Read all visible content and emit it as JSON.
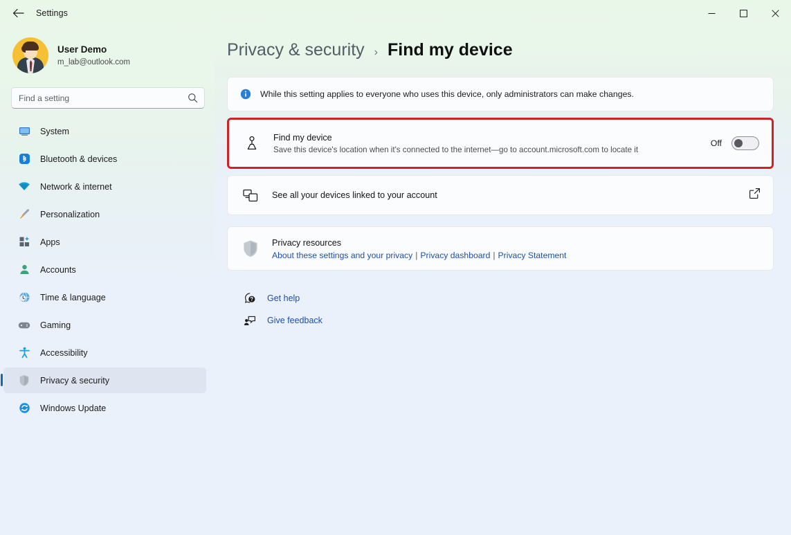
{
  "window": {
    "title": "Settings",
    "back_tooltip": "Back",
    "minimize": "Minimize",
    "maximize": "Maximize",
    "close": "Close",
    "accent_blue": "#1b4fa8",
    "highlight_red": "#cf2128",
    "mica_green": "#e9f7e9",
    "page_bg": "#eaf1fb"
  },
  "account": {
    "name": "User Demo",
    "email": "m_lab@outlook.com"
  },
  "search": {
    "placeholder": "Find a setting",
    "value": "",
    "icon": "search-icon"
  },
  "sidebar": {
    "items": [
      {
        "label": "System",
        "icon": "monitor-icon",
        "active": false
      },
      {
        "label": "Bluetooth & devices",
        "icon": "bluetooth-icon",
        "active": false
      },
      {
        "label": "Network & internet",
        "icon": "wifi-icon",
        "active": false
      },
      {
        "label": "Personalization",
        "icon": "paintbrush-icon",
        "active": false
      },
      {
        "label": "Apps",
        "icon": "apps-grid-icon",
        "active": false
      },
      {
        "label": "Accounts",
        "icon": "person-icon",
        "active": false
      },
      {
        "label": "Time & language",
        "icon": "clock-globe-icon",
        "active": false
      },
      {
        "label": "Gaming",
        "icon": "gamepad-icon",
        "active": false
      },
      {
        "label": "Accessibility",
        "icon": "accessibility-icon",
        "active": false
      },
      {
        "label": "Privacy & security",
        "icon": "shield-icon",
        "active": true
      },
      {
        "label": "Windows Update",
        "icon": "update-refresh-icon",
        "active": false
      }
    ]
  },
  "breadcrumb": {
    "parent": "Privacy & security",
    "separator": "›",
    "current": "Find my device"
  },
  "banner": {
    "icon": "info-icon",
    "text": "While this setting applies to everyone who uses this device, only administrators can make changes."
  },
  "find_my_device": {
    "icon": "location-person-icon",
    "title": "Find my device",
    "description": "Save this device's location when it's connected to the internet—go to account.microsoft.com to locate it",
    "toggle_label": "Off",
    "toggle_state": "off",
    "highlighted": true
  },
  "linked_devices": {
    "icon": "devices-icon",
    "title": "See all your devices linked to your account",
    "external_icon": "external-link-icon"
  },
  "privacy_resources": {
    "icon": "shield-icon",
    "title": "Privacy resources",
    "links": [
      "About these settings and your privacy",
      "Privacy dashboard",
      "Privacy Statement"
    ],
    "link_separator": "|"
  },
  "footer_links": [
    {
      "label": "Get help",
      "icon": "help-question-icon"
    },
    {
      "label": "Give feedback",
      "icon": "feedback-icon"
    }
  ]
}
